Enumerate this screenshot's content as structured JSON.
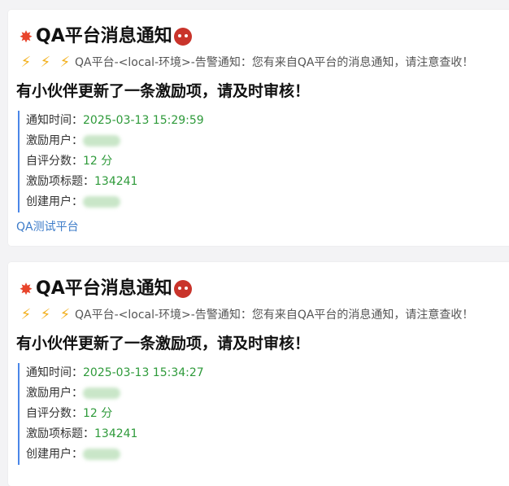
{
  "colors": {
    "accent_border": "#4a86e8",
    "value_green": "#2e9a3a",
    "link_blue": "#3d7cc9",
    "bolt_yellow": "#f2b01e"
  },
  "messages": [
    {
      "title": "QA平台消息通知",
      "subtitle": "QA平台-<local-环境>-告警通知：您有来自QA平台的消息通知，请注意查收！",
      "headline": "有小伙伴更新了一条激励项，请及时审核！",
      "fields": {
        "notify_time_label": "通知时间：",
        "notify_time_value": "2025-03-13 15:29:59",
        "reward_user_label": "激励用户：",
        "self_score_label": "自评分数：",
        "self_score_value": "12 分",
        "reward_title_label": "激励项标题：",
        "reward_title_value": "134241",
        "creator_label": "创建用户："
      },
      "link_text": "QA测试平台"
    },
    {
      "title": "QA平台消息通知",
      "subtitle": "QA平台-<local-环境>-告警通知：您有来自QA平台的消息通知，请注意查收！",
      "headline": "有小伙伴更新了一条激励项，请及时审核！",
      "fields": {
        "notify_time_label": "通知时间：",
        "notify_time_value": "2025-03-13 15:34:27",
        "reward_user_label": "激励用户：",
        "self_score_label": "自评分数：",
        "self_score_value": "12 分",
        "reward_title_label": "激励项标题：",
        "reward_title_value": "134241",
        "creator_label": "创建用户："
      }
    }
  ]
}
